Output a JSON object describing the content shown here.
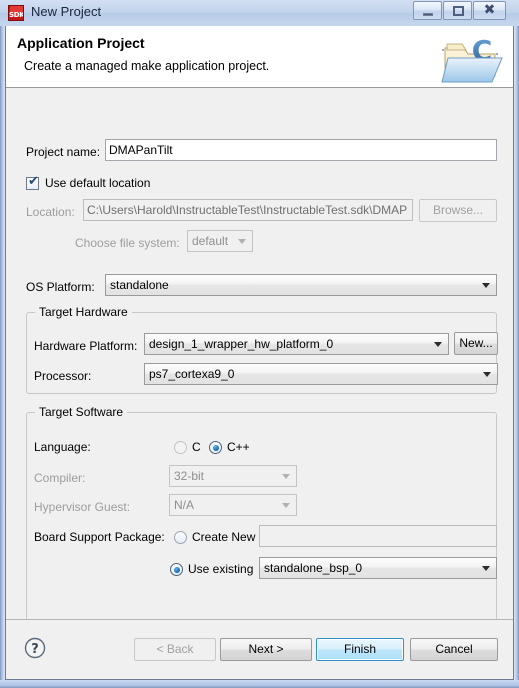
{
  "window": {
    "title": "New Project",
    "app_icon": "sdk-icon",
    "icon_label": "SDK",
    "controls": {
      "minimize": "minimize-icon",
      "maximize": "maximize-icon",
      "close": "close-icon"
    }
  },
  "header": {
    "title": "Application Project",
    "subtitle": "Create a managed make application project.",
    "icon": "folder-c-icon"
  },
  "form": {
    "project_name": {
      "label": "Project name:",
      "value": "DMAPanTilt",
      "placeholder": ""
    },
    "use_default_location": {
      "label": "Use default location",
      "checked": true,
      "check_glyph": "✔"
    },
    "location": {
      "label": "Location:",
      "value": "C:\\Users\\Harold\\InstructableTest\\InstructableTest.sdk\\DMAP",
      "disabled": true,
      "browse_label": "Browse..."
    },
    "file_system": {
      "label": "Choose file system:",
      "value": "default",
      "disabled": true
    },
    "os_platform": {
      "label": "OS Platform:",
      "value": "standalone"
    },
    "target_hardware": {
      "title": "Target Hardware",
      "hardware_platform": {
        "label": "Hardware Platform:",
        "value": "design_1_wrapper_hw_platform_0",
        "new_label": "New..."
      },
      "processor": {
        "label": "Processor:",
        "value": "ps7_cortexa9_0"
      }
    },
    "target_software": {
      "title": "Target Software",
      "language": {
        "label": "Language:",
        "options": [
          {
            "label": "C",
            "selected": false
          },
          {
            "label": "C++",
            "selected": true
          }
        ]
      },
      "compiler": {
        "label": "Compiler:",
        "value": "32-bit",
        "disabled": true
      },
      "hypervisor_guest": {
        "label": "Hypervisor Guest:",
        "value": "N/A",
        "disabled": true
      },
      "board_support_package": {
        "label": "Board Support Package:",
        "create_new": {
          "label": "Create New",
          "selected": false,
          "value": ""
        },
        "use_existing": {
          "label": "Use existing",
          "selected": true,
          "value": "standalone_bsp_0"
        }
      }
    }
  },
  "buttons": {
    "help": "help-icon",
    "back": {
      "label": "< Back",
      "disabled": true
    },
    "next": {
      "label": "Next >",
      "disabled": false
    },
    "finish": {
      "label": "Finish",
      "default": true
    },
    "cancel": {
      "label": "Cancel",
      "disabled": false
    }
  },
  "colors": {
    "accent": "#2e8fd1",
    "titlebar": "#bfd0ea",
    "body": "#f0f0f0",
    "icon_red": "#c2181a"
  }
}
